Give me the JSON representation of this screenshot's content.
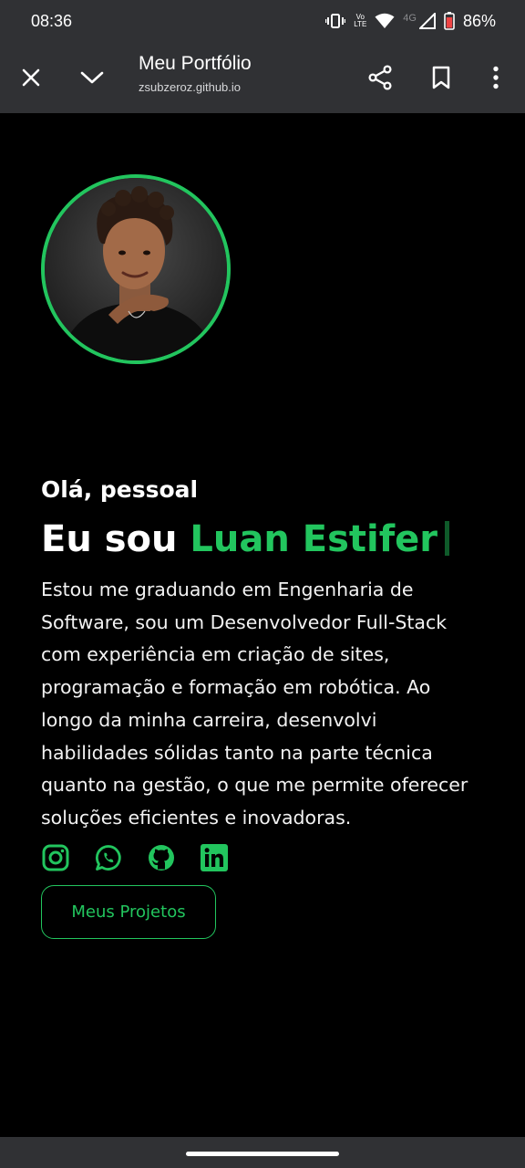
{
  "status_bar": {
    "time": "08:36",
    "lte_top": "Vo",
    "lte_bottom": "LTE",
    "network": "4G",
    "battery": "86%"
  },
  "toolbar": {
    "title": "Meu Portfólio",
    "url": "zsubzeroz.github.io"
  },
  "hero": {
    "greeting": "Olá, pessoal",
    "intro": "Eu sou ",
    "name": "Luan Estifer",
    "bio": "Estou me graduando em Engenharia de Software, sou um Desenvolvedor Full-Stack com experiência em criação de sites, programação e formação em robótica. Ao longo da minha carreira, desenvolvi habilidades sólidas tanto na parte técnica quanto na gestão, o que me permite oferecer soluções eficientes e inovadoras.",
    "projects_button": "Meus Projetos"
  },
  "socials": [
    "instagram-icon",
    "whatsapp-icon",
    "github-icon",
    "linkedin-icon"
  ],
  "colors": {
    "accent": "#22c55e",
    "chrome": "#303134",
    "background": "#000000"
  }
}
